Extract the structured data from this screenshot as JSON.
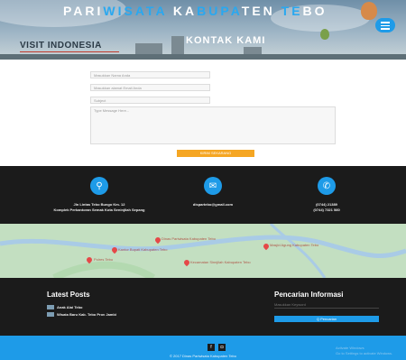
{
  "brand": {
    "segments": [
      {
        "text": "PARI",
        "highlight": false
      },
      {
        "text": "WISATA",
        "highlight": true
      },
      {
        "text": " KA",
        "highlight": false
      },
      {
        "text": "BUPA",
        "highlight": true
      },
      {
        "text": "TEN ",
        "highlight": false
      },
      {
        "text": "TE",
        "highlight": true
      },
      {
        "text": "BO",
        "highlight": false
      }
    ],
    "page_heading": "KONTAK KAMI",
    "logo_text": "VISIT INDONESIA"
  },
  "form": {
    "name_placeholder": "Masukkan Nama Anda",
    "email_placeholder": "Masukkan alamat Email Anda",
    "subject_placeholder": "Subject",
    "message_placeholder": "Type Message Here...",
    "submit_label": "KIRIM SEKARANG"
  },
  "contact": {
    "address_line1": "Jln Lintas Tebo Bungo Km. 12",
    "address_line2": "Komplek Perkantoran Semak Kota Seninjilah Sepang",
    "email": "dispartebo@gmail.com",
    "phone1": "(0744) 21389",
    "phone2": "(0744) 7321 580"
  },
  "map": {
    "labels": [
      "Dinas Pariwisata Kabupaten Tebo",
      "Kantor Bupati Kabupaten Tebo",
      "Masjid Agung Kabupaten Tebo",
      "Polres Tebo",
      "Kecamatan Sinnjilah Kabupaten Tebo"
    ]
  },
  "latest": {
    "title": "Latest Posts",
    "posts": [
      {
        "title": "Anak Alai Tebo"
      },
      {
        "title": "Wisata Baru Kab. Tebo Prov Jambi"
      }
    ]
  },
  "search": {
    "title": "Pencarian Informasi",
    "placeholder": "Masukkan Keyword",
    "button_label": "Q Pencarian"
  },
  "footer": {
    "copyright": "© 2017 Dinas Pariwisata Kabupaten Tebo",
    "watermark_line1": "Activate Windows",
    "watermark_line2": "Go to Settings to activate Windows."
  },
  "colors": {
    "accent": "#1e9be8",
    "highlight": "#29a8f0",
    "submit": "#f5a623",
    "dark": "#1b1b1b"
  }
}
